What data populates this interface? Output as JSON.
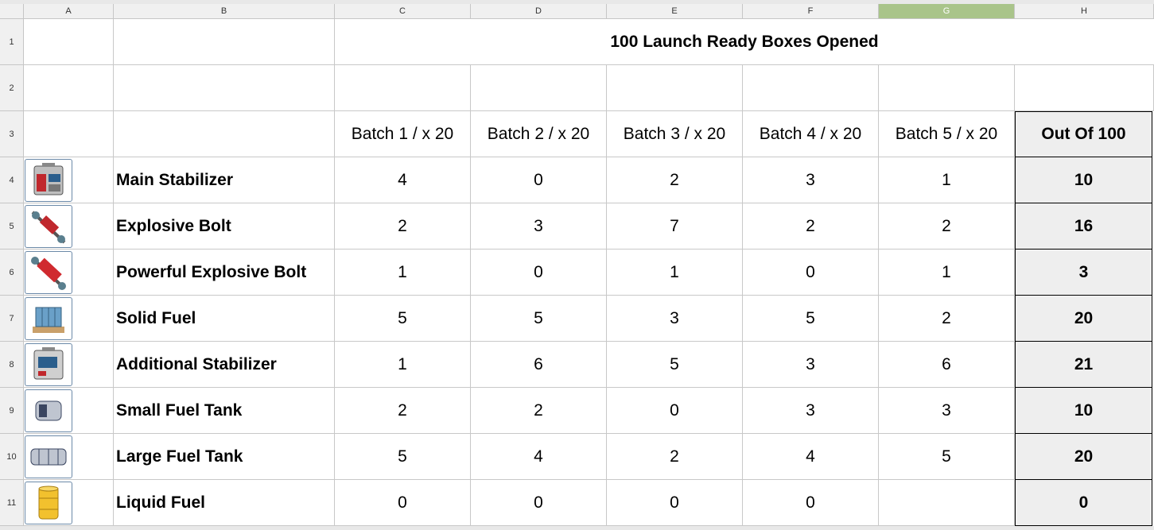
{
  "columns": [
    "A",
    "B",
    "C",
    "D",
    "E",
    "F",
    "G",
    "H"
  ],
  "selected_column": "G",
  "rows": [
    "1",
    "2",
    "3",
    "4",
    "5",
    "6",
    "7",
    "8",
    "9",
    "10",
    "11"
  ],
  "title": "100 Launch Ready Boxes Opened",
  "headers": [
    "Batch 1 / x 20",
    "Batch 2 / x 20",
    "Batch 3 / x 20",
    "Batch 4 / x 20",
    "Batch 5 / x 20"
  ],
  "total_header": "Out Of 100",
  "items": [
    {
      "name": "Main Stabilizer",
      "icon": "stabilizer-red-icon",
      "values": [
        "4",
        "0",
        "2",
        "3",
        "1"
      ],
      "total": "10"
    },
    {
      "name": "Explosive Bolt",
      "icon": "explosive-bolt-icon",
      "values": [
        "2",
        "3",
        "7",
        "2",
        "2"
      ],
      "total": "16"
    },
    {
      "name": "Powerful Explosive Bolt",
      "icon": "powerful-bolt-icon",
      "values": [
        "1",
        "0",
        "1",
        "0",
        "1"
      ],
      "total": "3"
    },
    {
      "name": "Solid Fuel",
      "icon": "solid-fuel-pallet-icon",
      "values": [
        "5",
        "5",
        "3",
        "5",
        "2"
      ],
      "total": "20"
    },
    {
      "name": "Additional Stabilizer",
      "icon": "stabilizer-grey-icon",
      "values": [
        "1",
        "6",
        "5",
        "3",
        "6"
      ],
      "total": "21"
    },
    {
      "name": "Small Fuel Tank",
      "icon": "small-tank-icon",
      "values": [
        "2",
        "2",
        "0",
        "3",
        "3"
      ],
      "total": "10"
    },
    {
      "name": "Large Fuel Tank",
      "icon": "large-tank-icon",
      "values": [
        "5",
        "4",
        "2",
        "4",
        "5"
      ],
      "total": "20"
    },
    {
      "name": "Liquid Fuel",
      "icon": "fuel-barrel-icon",
      "values": [
        "0",
        "0",
        "0",
        "0",
        ""
      ],
      "total": "0"
    }
  ]
}
